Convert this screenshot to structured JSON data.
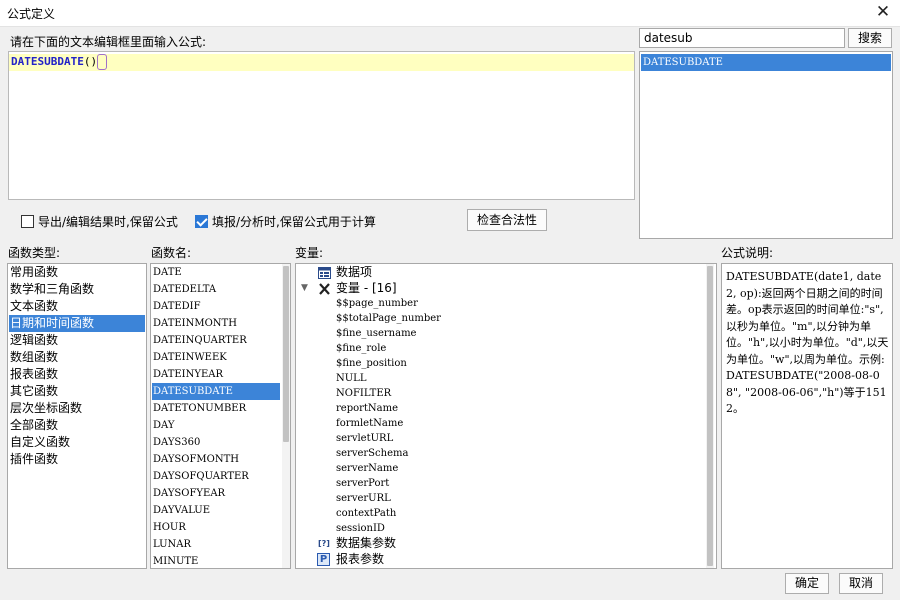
{
  "window": {
    "title": "公式定义",
    "close_glyph": "✕"
  },
  "editor": {
    "prompt": "请在下面的文本编辑框里面输入公式:",
    "function_name": "DATESUBDATE",
    "paren": "()"
  },
  "search": {
    "value": "datesub",
    "button_label": "搜索",
    "results": [
      "DATESUBDATE"
    ]
  },
  "options": {
    "keep_formula_export_label": "导出/编辑结果时,保留公式",
    "keep_formula_export_checked": false,
    "keep_formula_compute_label": "填报/分析时,保留公式用于计算",
    "keep_formula_compute_checked": true,
    "validate_button": "检查合法性"
  },
  "function_types": {
    "header": "函数类型:",
    "items": [
      "常用函数",
      "数学和三角函数",
      "文本函数",
      "日期和时间函数",
      "逻辑函数",
      "数组函数",
      "报表函数",
      "其它函数",
      "层次坐标函数",
      "全部函数",
      "自定义函数",
      "插件函数"
    ],
    "selected": "日期和时间函数"
  },
  "function_names": {
    "header": "函数名:",
    "items": [
      "DATE",
      "DATEDELTA",
      "DATEDIF",
      "DATEINMONTH",
      "DATEINQUARTER",
      "DATEINWEEK",
      "DATEINYEAR",
      "DATESUBDATE",
      "DATETONUMBER",
      "DAY",
      "DAYS360",
      "DAYSOFMONTH",
      "DAYSOFQUARTER",
      "DAYSOFYEAR",
      "DAYVALUE",
      "HOUR",
      "LUNAR",
      "MINUTE"
    ],
    "selected": "DATESUBDATE"
  },
  "variables": {
    "header": "变量:",
    "data_items": "数据项",
    "variables_label": "变量 - [16]",
    "expand_glyph": "▼",
    "items": [
      "$$page_number",
      "$$totalPage_number",
      "$fine_username",
      "$fine_role",
      "$fine_position",
      "NULL",
      "NOFILTER",
      "reportName",
      "formletName",
      "servletURL",
      "serverSchema",
      "serverName",
      "serverPort",
      "serverURL",
      "contextPath",
      "sessionID"
    ],
    "dataset_params": "数据集参数",
    "report_params": "报表参数",
    "icons": [
      "data-items-icon",
      "variables-icon",
      "dataset-params-icon",
      "report-params-icon"
    ],
    "icon_glyphs": {
      "dataset": "[?]",
      "report": "P"
    }
  },
  "description": {
    "header": "公式说明:",
    "text": "DATESUBDATE(date1, date2, op):返回两个日期之间的时间差。op表示返回的时间单位:\"s\",以秒为单位。\"m\",以分钟为单位。\"h\",以小时为单位。\"d\",以天为单位。\"w\",以周为单位。示例:DATESUBDATE(\"2008-08-08\", \"2008-06-06\",\"h\")等于1512。"
  },
  "footer": {
    "ok_button": "确定",
    "cancel_button": "取消"
  },
  "colors": {
    "selection": "#3c84d8",
    "editor_highlight": "#ffffc0",
    "function_text": "#2323c8"
  }
}
